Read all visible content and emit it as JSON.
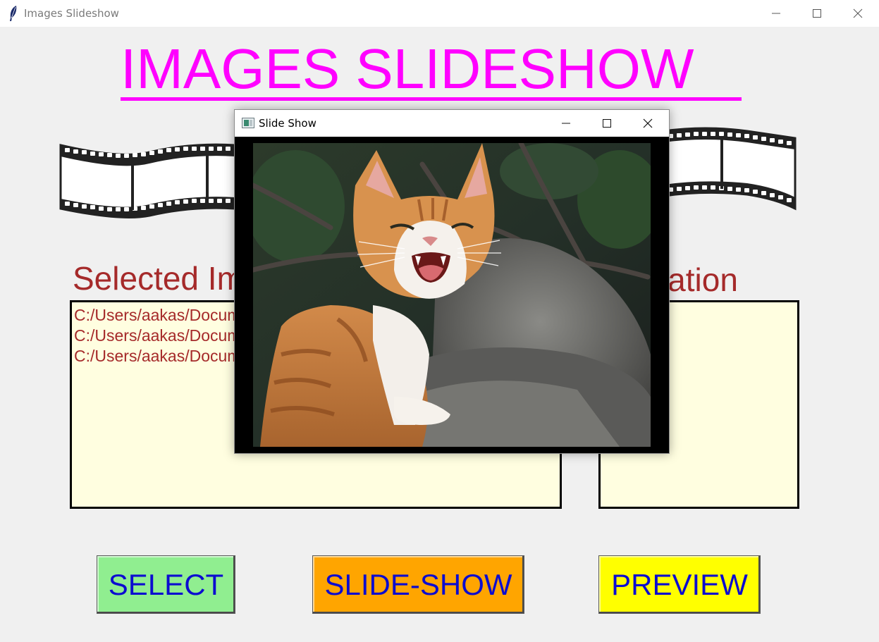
{
  "window": {
    "title": "Images Slideshow",
    "controls": [
      "minimize",
      "maximize",
      "close"
    ]
  },
  "heading": "IMAGES  SLIDESHOW",
  "sections": {
    "selected_label": "Selected Images",
    "location_label": "Location"
  },
  "selected_images": [
    "C:/Users/aakas/Documents",
    "C:/Users/aakas/Documents",
    "C:/Users/aakas/Documents"
  ],
  "buttons": {
    "select": "SELECT",
    "slideshow": "SLIDE-SHOW",
    "preview": "PREVIEW"
  },
  "popup": {
    "title": "Slide Show",
    "image_icon": "cat-photo"
  },
  "colors": {
    "heading": "#ff00ff",
    "label": "#a52a2a",
    "listbox_bg": "#fffee0",
    "select_button": "#90ee90",
    "slideshow_button": "#ffa500",
    "preview_button": "#ffff00",
    "button_text": "#0c0cd0"
  }
}
